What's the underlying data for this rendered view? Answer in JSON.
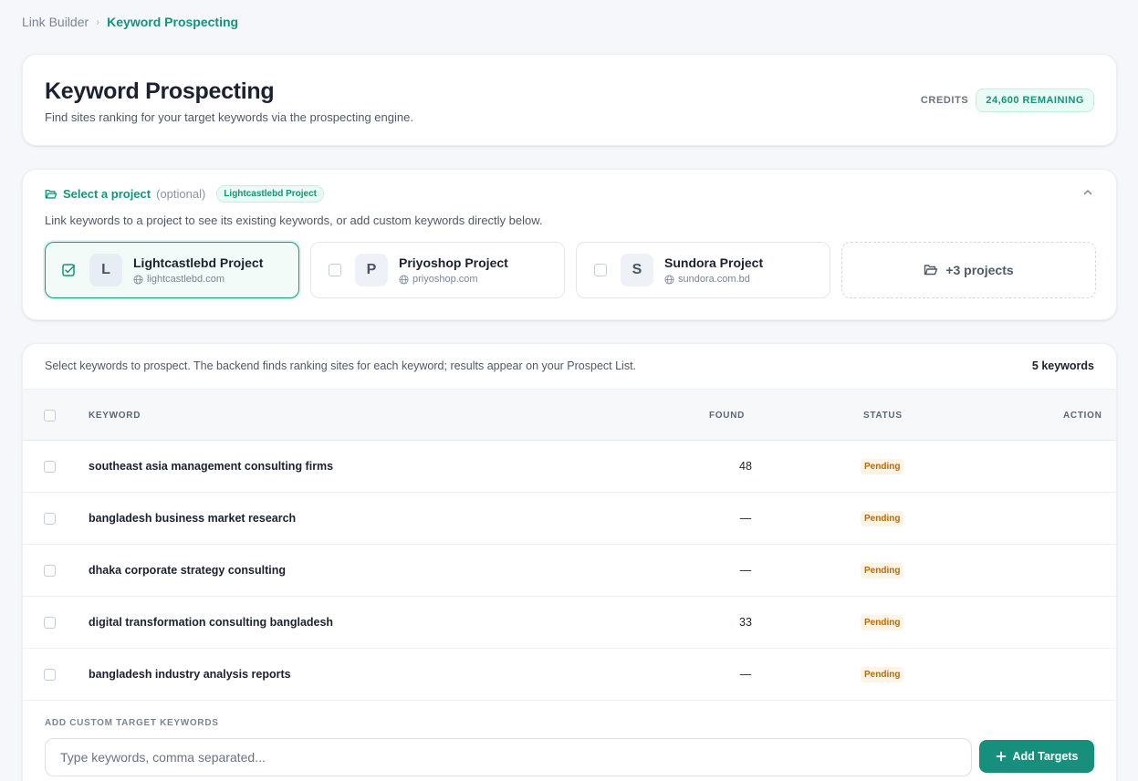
{
  "breadcrumb": {
    "root": "Link Builder",
    "separator": "›",
    "current": "Keyword Prospecting"
  },
  "header": {
    "title": "Keyword Prospecting",
    "subtitle": "Find sites ranking for your target keywords via the prospecting engine.",
    "credits_label": "CREDITS",
    "credits_value": "24,600 REMAINING"
  },
  "project_selector": {
    "label": "Select a project",
    "optional": "(optional)",
    "selected_pill": "Lightcastlebd Project",
    "description": "Link keywords to a project to see its existing keywords, or add custom keywords directly below.",
    "projects": [
      {
        "initial": "L",
        "name": "Lightcastlebd Project",
        "domain": "lightcastlebd.com",
        "selected": true
      },
      {
        "initial": "P",
        "name": "Priyoshop Project",
        "domain": "priyoshop.com",
        "selected": false
      },
      {
        "initial": "S",
        "name": "Sundora Project",
        "domain": "sundora.com.bd",
        "selected": false
      }
    ],
    "more_label": "+3 projects"
  },
  "keywords": {
    "intro": "Select keywords to prospect. The backend finds ranking sites for each keyword; results appear on your Prospect List.",
    "count": "5 keywords",
    "columns": {
      "keyword": "KEYWORD",
      "found": "FOUND",
      "status": "STATUS",
      "action": "ACTION"
    },
    "rows": [
      {
        "keyword": "southeast asia management consulting firms",
        "found": "48",
        "status": "Pending"
      },
      {
        "keyword": "bangladesh business market research",
        "found": "—",
        "status": "Pending"
      },
      {
        "keyword": "dhaka corporate strategy consulting",
        "found": "—",
        "status": "Pending"
      },
      {
        "keyword": "digital transformation consulting bangladesh",
        "found": "33",
        "status": "Pending"
      },
      {
        "keyword": "bangladesh industry analysis reports",
        "found": "—",
        "status": "Pending"
      }
    ]
  },
  "custom_keywords": {
    "label": "ADD CUSTOM TARGET KEYWORDS",
    "placeholder": "Type keywords, comma separated...",
    "button_label": "Add Targets"
  },
  "colors": {
    "accent": "#16907c",
    "pending": "#b76a0b",
    "background": "#f5f7fa"
  }
}
